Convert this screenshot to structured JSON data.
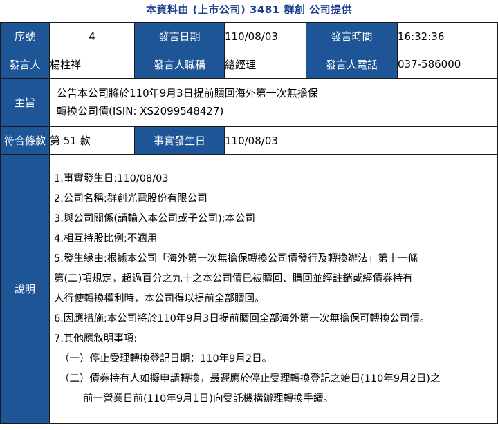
{
  "header": {
    "title": "本資料由 (上市公司) 3481 群創 公司提供"
  },
  "row1": {
    "seq_label": "序號",
    "seq_value": "4",
    "date_label": "發言日期",
    "date_value": "110/08/03",
    "time_label": "發言時間",
    "time_value": "16:32:36"
  },
  "row2": {
    "speaker_label": "發言人",
    "speaker_value": "楊柱祥",
    "position_label": "發言人職稱",
    "position_value": "總經理",
    "phone_label": "發言人電話",
    "phone_value": "037-586000"
  },
  "subject": {
    "label": "主旨",
    "line1": "公告本公司將於110年9月3日提前贖回海外第一次無擔保",
    "line2": "轉換公司債(ISIN: XS2099548427)"
  },
  "row4": {
    "clause_label": "符合條款",
    "clause_value": "第 51 款",
    "event_date_label": "事實發生日",
    "event_date_value": "110/08/03"
  },
  "description": {
    "label": "說明",
    "lines": [
      "1.事實發生日:110/08/03",
      "2.公司名稱:群創光電股份有限公司",
      "3.與公司關係(請輸入本公司或子公司):本公司",
      "4.相互持股比例:不適用",
      "5.發生緣由:根據本公司「海外第一次無擔保轉換公司債發行及轉換辦法」第十一條",
      "第(二)項規定，超過百分之九十之本公司債已被贖回、購回並經註銷或經債券持有",
      "人行使轉換權利時，本公司得以提前全部贖回。",
      "6.因應措施:本公司將於110年9月3日提前贖回全部海外第一次無擔保可轉換公司債。",
      "7.其他應敘明事項:",
      "（一）停止受理轉換登記日期：110年9月2日。",
      "（二）債券持有人如擬申請轉換，最遲應於停止受理轉換登記之始日(110年9月2日)之",
      "前一營業日前(110年9月1日)向受託機構辦理轉換手續。"
    ]
  },
  "colors": {
    "header_cell_bg": "#1d5596",
    "title_text": "#1b3f8f"
  }
}
